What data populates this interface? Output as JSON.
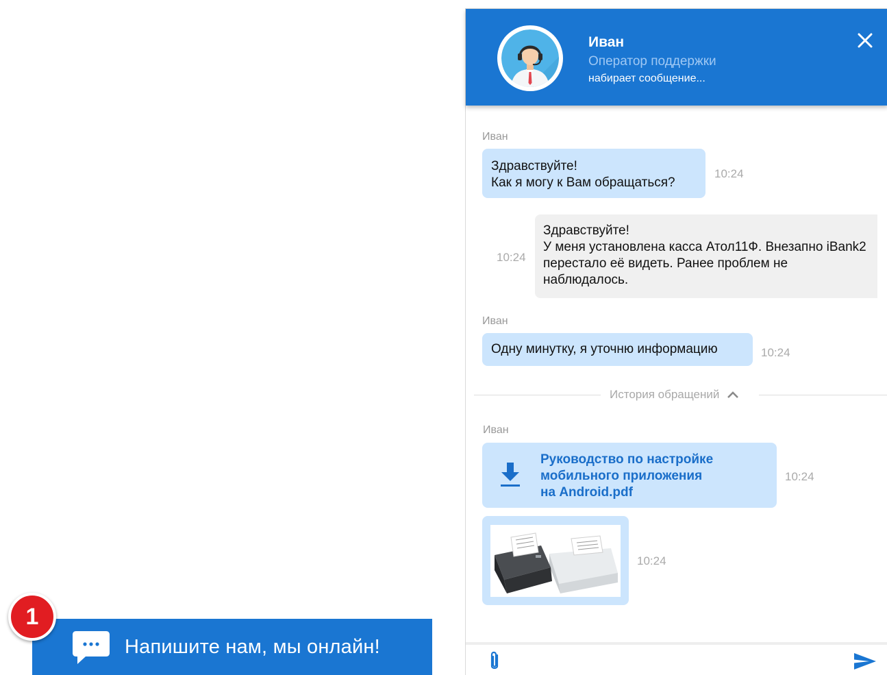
{
  "launcher": {
    "label": "Напишите нам, мы онлайн!",
    "badge_count": "1",
    "icon": "chat-bubble-icon"
  },
  "header": {
    "agent_name": "Иван",
    "agent_role": "Оператор поддержки",
    "status": "набирает сообщение...",
    "avatar_icon": "support-operator-avatar",
    "close_icon": "close-icon"
  },
  "messages": [
    {
      "sender": "Иван",
      "text": "Здравствуйте!\nКак я могу к Вам обращаться?",
      "time": "10:24",
      "direction": "incoming"
    },
    {
      "sender": "",
      "text": "Здравствуйте!\nУ меня установлена касса  Атол11Ф. Внезапно iBank2 перестало её видеть. Ранее проблем не наблюдалось.",
      "time": "10:24",
      "direction": "outgoing"
    },
    {
      "sender": "Иван",
      "text": "Одну минутку, я уточню информацию",
      "time": "10:24",
      "direction": "incoming"
    }
  ],
  "history": {
    "label": "История обращений",
    "icon": "chevron-up-icon"
  },
  "history_messages": {
    "sender": "Иван",
    "file": {
      "name": "Руководство по настройке\nмобильного приложения\nна Android.pdf",
      "time": "10:24",
      "icon": "download-icon"
    },
    "image": {
      "time": "10:24",
      "alt": "receipt-printers-image"
    }
  },
  "composer": {
    "placeholder": "",
    "attach_icon": "paperclip-icon",
    "send_icon": "send-icon"
  },
  "colors": {
    "primary": "#1a76d2",
    "incoming_bubble": "#cce5fd",
    "outgoing_bubble": "#f0f0f0",
    "badge": "#e11d22",
    "file_link": "#1a6ec9"
  }
}
